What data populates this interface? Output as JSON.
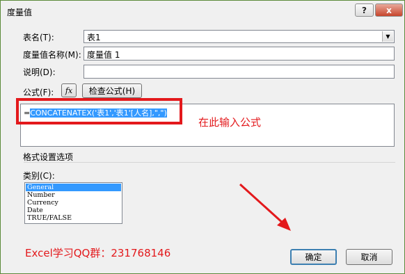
{
  "dialog": {
    "title": "度量值",
    "help_label": "?",
    "close_label": "x"
  },
  "table_name": {
    "label": "表名(T):",
    "value": "表1"
  },
  "measure_name": {
    "label": "度量值名称(M):",
    "value": "度量值 1"
  },
  "description": {
    "label": "说明(D):",
    "value": ""
  },
  "formula": {
    "label": "公式(F):",
    "fx_label": "fx",
    "check_button": "检查公式(H)",
    "text_prefix": "=",
    "text_selected": "CONCATENATEX('表1','表1'[人名],\",\")"
  },
  "annotation": {
    "hint": "在此输入公式",
    "qq_group": "Excel学习QQ群：231768146",
    "accent_color": "#e3191c"
  },
  "format": {
    "section_title": "格式设置选项",
    "category_label": "类别(C):",
    "categories": [
      "General",
      "Number",
      "Currency",
      "Date",
      "TRUE/FALSE"
    ],
    "selected_index": 0
  },
  "buttons": {
    "ok": "确定",
    "cancel": "取消"
  }
}
